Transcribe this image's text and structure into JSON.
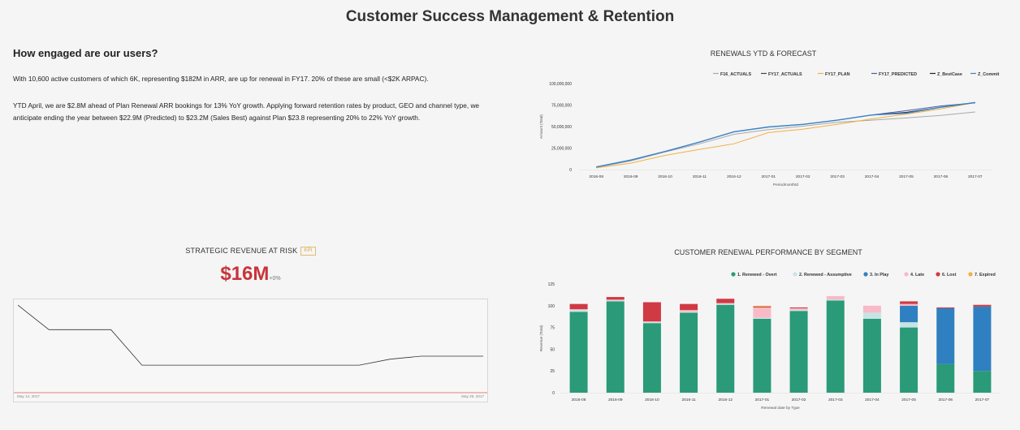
{
  "page": {
    "title": "Customer Success Management & Retention"
  },
  "engagement": {
    "heading": "How engaged are our users?",
    "paragraph1": "With 10,600 active customers of which 6K,  representing $182M in ARR, are up for renewal in FY17.  20% of these are small (<$2K ARPAC).",
    "paragraph2": "YTD April, we are $2.8M ahead of Plan Renewal ARR bookings for 13% YoY growth.   Applying forward  retention rates by product, GEO and channel type, we anticipate ending the year between $22.9M (Predicted) to $23.2M (Sales Best) against Plan $23.8 representing 20% to 22% YoY growth."
  },
  "risk": {
    "title": "STRATEGIC REVENUE AT RISK",
    "badge": "KPI",
    "value": "$16M",
    "delta": "+0%",
    "start_date": "May 14, 2017",
    "end_date": "May 29, 2017"
  },
  "colors": {
    "accent_red": "#c9343b",
    "badge_gold": "#d9a441"
  },
  "chart_data": [
    {
      "id": "renewals",
      "type": "line",
      "title": "RENEWALS YTD & FORECAST",
      "xlabel": "Periodmonthtd",
      "ylabel": "Amount (Total)",
      "ylim": [
        0,
        100000000
      ],
      "yticks": [
        0,
        25000000,
        50000000,
        75000000,
        100000000
      ],
      "ytick_labels": [
        "0",
        "25,000,000",
        "50,000,000",
        "75,000,000",
        "100,000,000"
      ],
      "legend_position": "top-right",
      "categories": [
        "2016-08",
        "2016-09",
        "2016-10",
        "2016-11",
        "2016-12",
        "2017-01",
        "2017-02",
        "2017-03",
        "2017-04",
        "2017-05",
        "2017-06",
        "2017-07"
      ],
      "series": [
        {
          "name": "F16_ACTUALS",
          "color": "#a8a8a8",
          "values": [
            2500000,
            10000000,
            20500000,
            30000000,
            41000000,
            46500000,
            50500000,
            55000000,
            57500000,
            60000000,
            63000000,
            67000000
          ]
        },
        {
          "name": "FY17_ACTUALS",
          "color": "#444444",
          "values": [
            3000000,
            11000000,
            21000000,
            32000000,
            44000000,
            49500000,
            52500000,
            57500000,
            63500000,
            null,
            null,
            null
          ]
        },
        {
          "name": "FY17_PLAN",
          "color": "#f2b045",
          "values": [
            2000000,
            7500000,
            16500000,
            23500000,
            30000000,
            43000000,
            47000000,
            52500000,
            59000000,
            64500000,
            70500000,
            78000000
          ]
        },
        {
          "name": "FY17_PREDICTED",
          "color": "#4a5aa8",
          "values": [
            null,
            null,
            null,
            null,
            null,
            null,
            null,
            null,
            63500000,
            68500000,
            74000000,
            77500000
          ]
        },
        {
          "name": "Z_BestCase",
          "color": "#222222",
          "values": [
            null,
            null,
            null,
            null,
            null,
            null,
            null,
            null,
            63500000,
            66500000,
            72500000,
            77800000
          ]
        },
        {
          "name": "Z_Commit",
          "color": "#3d85c6",
          "values": [
            3000000,
            11000000,
            21000000,
            32000000,
            44000000,
            49500000,
            52500000,
            57500000,
            63500000,
            65500000,
            72500000,
            78000000
          ]
        }
      ]
    },
    {
      "id": "segment",
      "type": "bar",
      "stacked": true,
      "title": "CUSTOMER RENEWAL PERFORMANCE BY SEGMENT",
      "xlabel": "Renewal date by Type",
      "ylabel": "Revenue (Total)",
      "ylim": [
        0,
        125
      ],
      "yticks": [
        0,
        25,
        50,
        75,
        100,
        125
      ],
      "legend_position": "top-right",
      "categories": [
        "2016-08",
        "2016-09",
        "2016-10",
        "2016-11",
        "2016-12",
        "2017-01",
        "2017-02",
        "2017-03",
        "2017-04",
        "2017-05",
        "2017-06",
        "2017-07"
      ],
      "series": [
        {
          "name": "1. Renewed - Overt",
          "color": "#2a9a78",
          "values": [
            93,
            105,
            80,
            92,
            101,
            85,
            94,
            106,
            85,
            75,
            33,
            25
          ]
        },
        {
          "name": "2. Renewed - Assumptive",
          "color": "#c6e4e6",
          "values": [
            2,
            1,
            1,
            1,
            1,
            1,
            1,
            1,
            7,
            6,
            0,
            0
          ]
        },
        {
          "name": "3. In Play",
          "color": "#2f80c0",
          "values": [
            0,
            0,
            0,
            0,
            0,
            0,
            0,
            0,
            0,
            19,
            64,
            74
          ]
        },
        {
          "name": "4. Late",
          "color": "#f7bac6",
          "values": [
            1,
            1,
            1,
            2,
            1,
            12,
            2,
            4,
            8,
            2,
            0,
            0
          ]
        },
        {
          "name": "6. Lost",
          "color": "#d03a43",
          "values": [
            6,
            3,
            22,
            7,
            5,
            1,
            1,
            0,
            0,
            3,
            1,
            2
          ]
        },
        {
          "name": "7. Expired",
          "color": "#f2b045",
          "values": [
            0,
            0,
            0,
            0,
            0,
            1,
            0,
            0,
            0,
            0,
            0,
            0
          ]
        }
      ]
    },
    {
      "id": "risk",
      "type": "line",
      "title": "STRATEGIC REVENUE AT RISK",
      "x": [
        "May 14, 2017",
        "May 15, 2017",
        "May 16, 2017",
        "May 17, 2017",
        "May 18, 2017",
        "May 19, 2017",
        "May 20, 2017",
        "May 21, 2017",
        "May 22, 2017",
        "May 23, 2017",
        "May 24, 2017",
        "May 25, 2017",
        "May 26, 2017",
        "May 27, 2017",
        "May 28, 2017",
        "May 29, 2017"
      ],
      "series": [
        {
          "name": "",
          "color": "#333333",
          "values": [
            27.5,
            22.6,
            22.6,
            22.6,
            15.5,
            15.5,
            15.5,
            15.5,
            15.5,
            15.5,
            15.5,
            15.5,
            16.7,
            17.3,
            17.3,
            17.3
          ]
        }
      ],
      "ylim": [
        10,
        28
      ],
      "baseline": {
        "value": 10,
        "color": "#e0544f"
      }
    }
  ]
}
